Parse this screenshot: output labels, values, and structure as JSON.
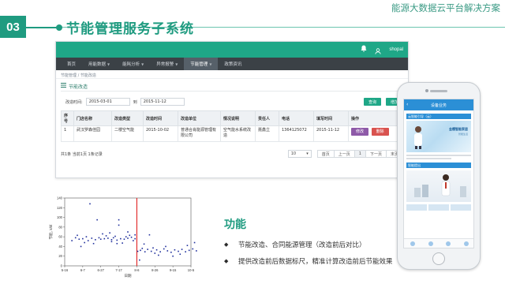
{
  "header": {
    "number": "03",
    "title": "节能管理服务子系统",
    "tagline": "能源大数据云平台解决方案"
  },
  "app": {
    "user": "shopal",
    "nav": [
      "首页",
      "用能数据",
      "能耗分析",
      "异常报警",
      "节能管理",
      "政策资讯"
    ],
    "active_nav": "节能管理",
    "breadcrumb": "节能管理 / 节能改造",
    "panel_title": "节能改造",
    "filter": {
      "label": "改造时间:",
      "from": "2015-03-01",
      "to_label": "到",
      "to": "2015-11-12",
      "query_label": "查询",
      "add_label": "增加"
    },
    "table": {
      "columns": [
        "序号",
        "门店名称",
        "改造类型",
        "改造时间",
        "改造单位",
        "情况说明",
        "责任人",
        "电话",
        "填写时间",
        "操作"
      ],
      "rows": [
        {
          "no": "1",
          "store": "武汉罗森佳园",
          "type": "二楼空气能",
          "time": "2015-10-02",
          "unit": "普通合肖能源管理有限公司",
          "desc": "空气能水系统改造",
          "owner": "聂鑫立",
          "phone": "1364125072",
          "filled": "2015-11-12",
          "edit_label": "修改",
          "delete_label": "删除"
        }
      ]
    },
    "footer": {
      "summary": "共1条  当前1页  1条记录",
      "page_size": "10",
      "first": "首页",
      "prev": "上一页",
      "current": "1",
      "next": "下一页",
      "last": "末页"
    }
  },
  "phone": {
    "title": "设备业务",
    "tag1": "云智能引导（云）",
    "banner1_title": "金樱智能家居",
    "banner1_sub": "智能生活",
    "tag2": "智能提出"
  },
  "chart_data": {
    "type": "scatter",
    "title": "",
    "xlabel": "日期",
    "ylabel": "节能, kW",
    "x_ticks": [
      "5-16",
      "6-7",
      "6-27",
      "7-17",
      "8-6",
      "8-26",
      "9-15",
      "10-5"
    ],
    "y_ticks": [
      "0",
      "20",
      "40",
      "60",
      "80",
      "100",
      "120",
      "140"
    ],
    "ylim": [
      0,
      140
    ],
    "marker_line_at": "8-6",
    "marker_color": "#e02020",
    "point_color": "#1f2f9c",
    "before": [
      [
        0.4,
        52
      ],
      [
        0.6,
        58
      ],
      [
        0.8,
        55
      ],
      [
        1.0,
        56
      ],
      [
        1.2,
        60
      ],
      [
        1.3,
        52
      ],
      [
        1.5,
        57
      ],
      [
        1.7,
        54
      ],
      [
        1.9,
        58
      ],
      [
        2.0,
        55
      ],
      [
        2.2,
        56
      ],
      [
        2.4,
        57
      ],
      [
        2.6,
        54
      ],
      [
        2.7,
        58
      ],
      [
        2.9,
        53
      ],
      [
        3.1,
        56
      ],
      [
        3.3,
        55
      ],
      [
        3.5,
        57
      ],
      [
        3.7,
        59
      ],
      [
        3.9,
        56
      ],
      [
        1.1,
        48
      ],
      [
        1.6,
        46
      ],
      [
        2.3,
        62
      ],
      [
        2.8,
        61
      ],
      [
        3.2,
        47
      ],
      [
        3.6,
        63
      ],
      [
        3.8,
        52
      ],
      [
        0.9,
        40
      ],
      [
        2.5,
        68
      ],
      [
        3.4,
        60
      ],
      [
        1.4,
        128
      ],
      [
        2.1,
        66
      ],
      [
        2.9,
        46
      ],
      [
        3.0,
        84
      ],
      [
        3.5,
        70
      ],
      [
        1.8,
        95
      ],
      [
        3.0,
        95
      ],
      [
        0.7,
        63
      ],
      [
        3.9,
        64
      ],
      [
        2.6,
        50
      ]
    ],
    "after": [
      [
        4.05,
        30
      ],
      [
        4.2,
        32
      ],
      [
        4.3,
        36
      ],
      [
        4.45,
        29
      ],
      [
        4.6,
        34
      ],
      [
        4.8,
        30
      ],
      [
        4.9,
        37
      ],
      [
        5.1,
        33
      ],
      [
        5.3,
        29
      ],
      [
        5.5,
        35
      ],
      [
        5.7,
        31
      ],
      [
        5.9,
        28
      ],
      [
        6.1,
        33
      ],
      [
        6.3,
        30
      ],
      [
        6.5,
        34
      ],
      [
        6.7,
        29
      ],
      [
        6.9,
        32
      ],
      [
        7.1,
        35
      ],
      [
        7.3,
        31
      ],
      [
        7.5,
        45
      ],
      [
        7.55,
        38
      ],
      [
        7.6,
        52
      ],
      [
        7.4,
        28
      ],
      [
        6.0,
        20
      ],
      [
        5.2,
        22
      ],
      [
        4.4,
        45
      ],
      [
        4.7,
        64
      ],
      [
        6.8,
        42
      ],
      [
        5.0,
        26
      ],
      [
        7.2,
        48
      ],
      [
        4.15,
        12
      ],
      [
        5.6,
        40
      ],
      [
        6.4,
        24
      ]
    ]
  },
  "features": {
    "title": "功能",
    "items": [
      "节能改造、合同能源管理（改造前后对比）",
      "提供改造前后数据标尺，精准计算改造前后节能效果"
    ]
  }
}
